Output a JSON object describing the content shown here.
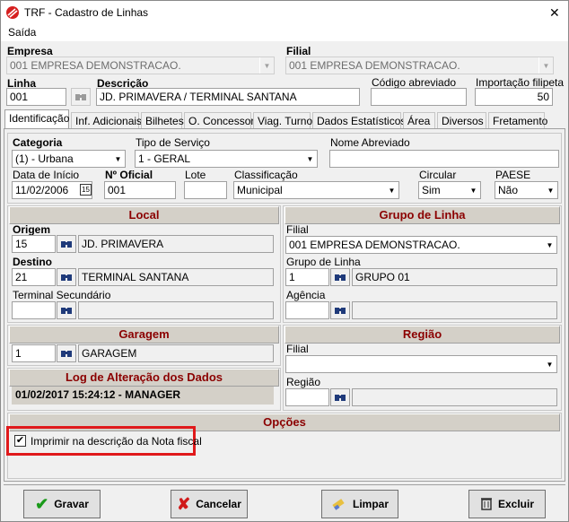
{
  "window": {
    "title": "TRF - Cadastro de Linhas",
    "close_glyph": "✕"
  },
  "menu": {
    "saida": "Saída"
  },
  "header": {
    "empresa_label": "Empresa",
    "empresa_value": "001 EMPRESA DEMONSTRACAO.",
    "filial_label": "Filial",
    "filial_value": "001 EMPRESA DEMONSTRACAO.",
    "linha_label": "Linha",
    "linha_value": "001",
    "descricao_label": "Descrição",
    "descricao_value": "JD. PRIMAVERA / TERMINAL SANTANA",
    "codigo_label": "Código abreviado",
    "codigo_value": "",
    "importacao_label": "Importação filipeta",
    "importacao_value": "50"
  },
  "tabs": [
    "Identificação",
    "Inf. Adicionais",
    "Bilhetes",
    "O. Concessor",
    "Viag. Turno",
    "Dados Estatísticos",
    "Área",
    "Diversos",
    "Fretamento"
  ],
  "ident": {
    "categoria_label": "Categoria",
    "categoria_value": "(1) - Urbana",
    "tipo_label": "Tipo de Serviço",
    "tipo_value": "1 - GERAL",
    "nome_abrev_label": "Nome Abreviado",
    "nome_abrev_value": "",
    "data_label": "Data de Início",
    "data_value": "11/02/2006",
    "cal_glyph": "15",
    "oficial_label": "Nº Oficial",
    "oficial_value": "001",
    "lote_label": "Lote",
    "lote_value": "",
    "classif_label": "Classificação",
    "classif_value": "Municipal",
    "circular_label": "Circular",
    "circular_value": "Sim",
    "paese_label": "PAESE",
    "paese_value": "Não"
  },
  "local": {
    "title": "Local",
    "origem_label": "Origem",
    "origem_code": "15",
    "origem_name": "JD. PRIMAVERA",
    "destino_label": "Destino",
    "destino_code": "21",
    "destino_name": "TERMINAL SANTANA",
    "terminal_label": "Terminal Secundário",
    "terminal_code": "",
    "terminal_name": ""
  },
  "grupo": {
    "title": "Grupo de Linha",
    "filial_label": "Filial",
    "filial_value": "001 EMPRESA DEMONSTRACAO.",
    "grupo_label": "Grupo de Linha",
    "grupo_code": "1",
    "grupo_name": "GRUPO 01",
    "agencia_label": "Agência",
    "agencia_code": "",
    "agencia_name": ""
  },
  "garagem": {
    "title": "Garagem",
    "code": "1",
    "name": "GARAGEM"
  },
  "regiao": {
    "title": "Região",
    "filial_label": "Filial",
    "filial_value": "",
    "regiao_label": "Região",
    "regiao_code": "",
    "regiao_name": ""
  },
  "log": {
    "title": "Log de Alteração dos Dados",
    "value": "01/02/2017 15:24:12 - MANAGER"
  },
  "opcoes": {
    "title": "Opções",
    "checkbox_label": "Imprimir na descrição da Nota fiscal",
    "checked": true
  },
  "buttons": {
    "gravar": "Gravar",
    "cancelar": "Cancelar",
    "limpar": "Limpar",
    "excluir": "Excluir"
  },
  "colors": {
    "group_title": "#8b0000",
    "highlight": "#e0191b"
  }
}
